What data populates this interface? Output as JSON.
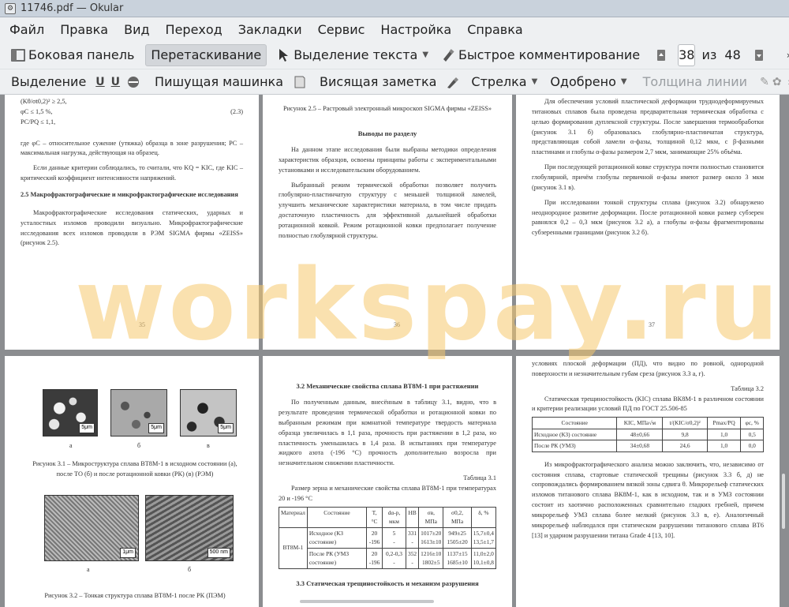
{
  "window": {
    "title": "11746.pdf  — Okular"
  },
  "menu": [
    "Файл",
    "Правка",
    "Вид",
    "Переход",
    "Закладки",
    "Сервис",
    "Настройка",
    "Справка"
  ],
  "toolbar1": {
    "sidebar": "Боковая панель",
    "browse": "Перетаскивание",
    "text_select": "Выделение текста",
    "quick_annot": "Быстрое комментирование",
    "page_current": "38",
    "page_of": "из",
    "page_total": "48"
  },
  "toolbar2": {
    "selection": "Выделение",
    "typewriter": "Пишущая машинка",
    "popup_note": "Висящая заметка",
    "arrow": "Стрелка",
    "approved": "Одобрено",
    "line_width": "Толщина линии"
  },
  "watermark": "workspay.ru",
  "pages": {
    "p35": {
      "formulas": [
        "(Kθ/σt0,2)² ≥ 2,5,",
        "φC ≤ 1,5 %,",
        "PC/PQ ≤ 1,1,"
      ],
      "eq_num": "(2.3)",
      "para1": "где φC – относительное сужение (утяжка) образца в зоне разрушения; PC – максимальная нагрузка, действующая на образец.",
      "para2": "Если данные критерии соблюдались, то считали, что KQ = KIC, где KIC – критический коэффициент интенсивности напряжений.",
      "heading": "2.5 Макрофрактографические и микрофрактографические исследования",
      "para3": "Макрофрактографические исследования статических, ударных и усталостных изломов проводили визуально. Микрофрактографические исследования всех изломов проводили в РЭМ SIGMA фирмы «ZEISS» (рисунок 2.5).",
      "num": "35"
    },
    "p36": {
      "caption": "Рисунок 2.5 – Растровый электронный микроскоп SIGMA фирмы «ZEISS»",
      "heading": "Выводы по разделу",
      "para1": "На данном этапе исследования были выбраны методики определения характеристик образцов, освоены принципы работы с экспериментальными установками и исследовательским оборудованием.",
      "para2": "Выбранный режим термической обработки позволяет получить глобулярно-пластинчатую структуру с меньшей толщиной ламелей, улучшить механические характеристики материала, в том числе придать достаточную пластичность для эффективной дальнейшей обработки ротационной ковкой. Режим ротационной ковки предполагает получение полностью глобулярной структуры.",
      "num": "36"
    },
    "p37": {
      "para1": "Для обеспечения условий пластической деформации труднодеформируемых титановых сплавов была проведена предварительная термическая обработка с целью формирования дуплексной структуры. После завершения термообработки (рисунок 3.1 б) образовалась глобулярно-пластинчатая структура, представляющая собой ламели α-фазы, толщиной 0,12 мкм, с β-фазными пластинами и глобулы α-фазы размером 2,7 мкм, занимающие 25% объёма.",
      "para2": "При последующей ротационной ковке структура почти полностью становится глобулярной, причём глобулы первичной α-фазы имеют размер около 3 мкм (рисунок 3.1 в).",
      "para3": "При исследовании тонкой структуры сплава (рисунок 3.2) обнаружено неоднородное развитие деформации. После ротационной ковки размер субзерен равнялся 0,2 – 0,3 мкм (рисунок 3.2 а), а глобулы α-фазы фрагментированы субзеренными границами (рисунок 3.2 б).",
      "num": "37"
    },
    "p38": {
      "labels1": [
        "а",
        "б",
        "в"
      ],
      "scale1": [
        "5μm",
        "5μm",
        "5μm"
      ],
      "caption1": "Рисунок 3.1 – Микроструктура сплава ВТ8М-1 в исходном состоянии (а), после ТО (б) и после ротационной ковки (РК) (в) (РЭМ)",
      "labels2": [
        "а",
        "б"
      ],
      "scale2": [
        "1μm",
        "500 nm"
      ],
      "caption2": "Рисунок 3.2 – Тонкая структура сплава ВТ8М-1 после РК (ПЭМ)"
    },
    "p39": {
      "heading": "3.2 Механические свойства сплава ВТ8М-1 при растяжении",
      "para1": "По полученным данным, внесённым в таблицу 3.1, видно, что в результате проведения термической обработки и ротационной ковки по выбранным режимам при комнатной температуре твердость материала образца увеличилась в 1,1 раза, прочность при растяжении в 1,2 раза, но пластичность уменьшилась в 1,4 раза. В испытаниях при температуре жидкого азота (-196 °С) прочность дополнительно возросла при незначительном снижении пластичности.",
      "table_label": "Таблица 3.1",
      "table_title": "Размер зерна и механические свойства сплава ВТ8М-1 при температурах 20 и -196 °С",
      "table_headers": [
        "Материал",
        "Состояние",
        "T, °С",
        "dα-р, мкм",
        "HB",
        "σв, МПа",
        "σ0,2, МПа",
        "δ, %"
      ],
      "table_material": "ВТ8М-1",
      "table_rows": [
        [
          "Исходное (КЗ состояние)",
          "20\n-196",
          "5\n-",
          "331\n-",
          "1017±20\n1613±10",
          "949±25\n1505±20",
          "15,7±0,4\n13,5±1,7"
        ],
        [
          "После РК (УМЗ состояние)",
          "20\n-196",
          "0,2-0,3\n-",
          "352\n-",
          "1216±10\n1802±5",
          "1137±15\n1685±10",
          "11,0±2,0\n10,1±0,8"
        ]
      ],
      "heading2": "3.3 Статическая трещиностойкость и механизм разрушения"
    },
    "p40": {
      "para1": "условиях плоской деформации (ПД), что видно по ровной, однородной поверхности и незначительным губам среза (рисунок 3.3 а, г).",
      "table_label": "Таблица 3.2",
      "table_title": "Статическая трещиностойкость (KIC) сплава ВК8М-1 в различном состоянии и критерии реализации условий ПД по ГОСТ 25.506-85",
      "table_headers": [
        "Состояние",
        "KIC, МПа√м",
        "t/(KIC/σ0,2)²",
        "Pmax/PQ",
        "φc, %"
      ],
      "table_rows": [
        [
          "Исходное (КЗ) состояние",
          "48±0,66",
          "9,8",
          "1,0",
          "0,5"
        ],
        [
          "После РК (УМЗ)",
          "34±0,68",
          "24,6",
          "1,0",
          "0,0"
        ]
      ],
      "para2": "Из микрофрактографического анализа можно заключить, что, независимо от состояния сплава, стартовые статической трещины (рисунок 3.3 б, д) не сопровождались формированием вязкой зоны сдвига θ. Микрорельеф статических изломов титанового сплава ВК8М-1, как в исходном, так и в УМЗ состоянии состоит из хаотично расположенных сравнительно гладких гребней, причем микрорельеф УМЗ сплава более мелкий (рисунок 3.3 в, е). Аналогичный микрорельеф наблюдался при статическом разрушении титанового сплава ВТ6 [13] и ударном разрушении титана Grade 4 [13, 10]."
    }
  }
}
